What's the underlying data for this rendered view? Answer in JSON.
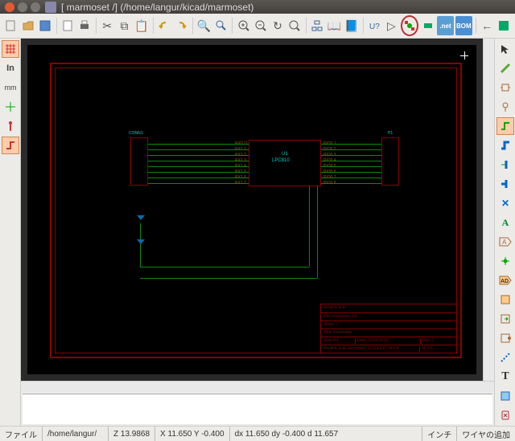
{
  "window": {
    "title": "[ marmoset /] (/home/langur/kicad/marmoset)"
  },
  "component": {
    "main_ref": "U1",
    "main_value": "LPC810",
    "conn_left_ref": "CONN1",
    "conn_right_ref": "P1",
    "pins_left": [
      "RX0.11",
      "RX1.1",
      "RX1.2",
      "RX1.3",
      "RX1.4",
      "RX1.5",
      "RX1.6",
      "RX1.7"
    ],
    "pins_right": [
      "PIO0.1",
      "PIO0.2",
      "PIO0.3",
      "PIO0.4",
      "PIO0.5",
      "PIO0.6",
      "PIO0.7",
      "PIO0.8"
    ]
  },
  "titleblock": {
    "title": "Kicad E.D.A.",
    "file": "File: marmoset.sch",
    "sheet": "Sheet: /",
    "project": "Title: marmoset",
    "size": "Size: A4",
    "date": "Date: 2014-01-05",
    "rev": "Rev: 1",
    "id": "Id: 1/1",
    "drawn": "Kicad E.D.A.  eeschema  2013-jul-07-r4024"
  },
  "status": {
    "file_label": "ファイル",
    "file_path": "/home/langur/",
    "zoom": "Z 13.9868",
    "xy": "X 11.650 Y -0.400",
    "dxy": "dx 11.650  dy -0.400  d 11.657",
    "unit": "インチ",
    "mode": "ワイヤの追加"
  },
  "colors": {
    "page_border": "#8b0000",
    "wire": "#0b8a0b",
    "component_text": "#00d4cc"
  }
}
